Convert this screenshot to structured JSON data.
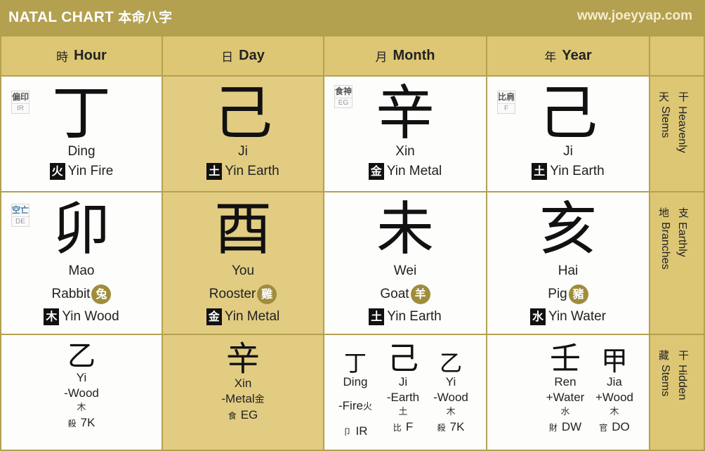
{
  "header": {
    "title": "NATAL CHART",
    "title_cn": "本命八字",
    "site": "www.joeyyap.com"
  },
  "columns": [
    {
      "cn": "時",
      "label": "Hour"
    },
    {
      "cn": "日",
      "label": "Day"
    },
    {
      "cn": "月",
      "label": "Month"
    },
    {
      "cn": "年",
      "label": "Year"
    }
  ],
  "side": {
    "stems": {
      "cn": [
        "天",
        "干"
      ],
      "label": [
        "Heavenly",
        "Stems"
      ]
    },
    "branches": {
      "cn": [
        "地",
        "支"
      ],
      "label": [
        "Earthly",
        "Branches"
      ]
    },
    "hidden": {
      "cn": [
        "藏",
        "干"
      ],
      "label": [
        "Hidden",
        "Stems"
      ]
    }
  },
  "stems": [
    {
      "char": "丁",
      "pinyin": "Ding",
      "el_char": "火",
      "element": "Yin Fire",
      "badge_cn": "偏印",
      "badge": "IR"
    },
    {
      "char": "己",
      "pinyin": "Ji",
      "el_char": "土",
      "element": "Yin Earth"
    },
    {
      "char": "辛",
      "pinyin": "Xin",
      "el_char": "金",
      "element": "Yin Metal",
      "badge_cn": "食神",
      "badge": "EG"
    },
    {
      "char": "己",
      "pinyin": "Ji",
      "el_char": "土",
      "element": "Yin Earth",
      "badge_cn": "比肩",
      "badge": "F"
    }
  ],
  "branches": [
    {
      "char": "卯",
      "pinyin": "Mao",
      "animal": "Rabbit",
      "animal_cn": "兔",
      "el_char": "木",
      "element": "Yin Wood",
      "badge_cn": "空亡",
      "badge": "DE"
    },
    {
      "char": "酉",
      "pinyin": "You",
      "animal": "Rooster",
      "animal_cn": "雞",
      "el_char": "金",
      "element": "Yin Metal"
    },
    {
      "char": "未",
      "pinyin": "Wei",
      "animal": "Goat",
      "animal_cn": "羊",
      "el_char": "土",
      "element": "Yin Earth"
    },
    {
      "char": "亥",
      "pinyin": "Hai",
      "animal": "Pig",
      "animal_cn": "豬",
      "el_char": "水",
      "element": "Yin Water"
    }
  ],
  "hidden": {
    "hour": [
      {
        "char": "乙",
        "pinyin": "Yi",
        "element": "-Wood",
        "el_cn": "木",
        "god_cn": "殺",
        "god": "7K"
      }
    ],
    "day": [
      {
        "char": "辛",
        "pinyin": "Xin",
        "element": "-Metal",
        "el_cn": "金",
        "god_cn": "食",
        "god": "EG"
      }
    ],
    "month": [
      {
        "char": "丁",
        "pinyin": "Ding",
        "element": "-Fire",
        "el_cn": "火",
        "god_cn": "卩",
        "god": "IR"
      },
      {
        "char": "己",
        "pinyin": "Ji",
        "element": "-Earth",
        "el_cn": "土",
        "god_cn": "比",
        "god": "F"
      },
      {
        "char": "乙",
        "pinyin": "Yi",
        "element": "-Wood",
        "el_cn": "木",
        "god_cn": "殺",
        "god": "7K"
      }
    ],
    "year": [
      {
        "char": "壬",
        "pinyin": "Ren",
        "element": "+Water",
        "el_cn": "水",
        "god_cn": "財",
        "god": "DW"
      },
      {
        "char": "甲",
        "pinyin": "Jia",
        "element": "+Wood",
        "el_cn": "木",
        "god_cn": "官",
        "god": "DO"
      }
    ]
  }
}
